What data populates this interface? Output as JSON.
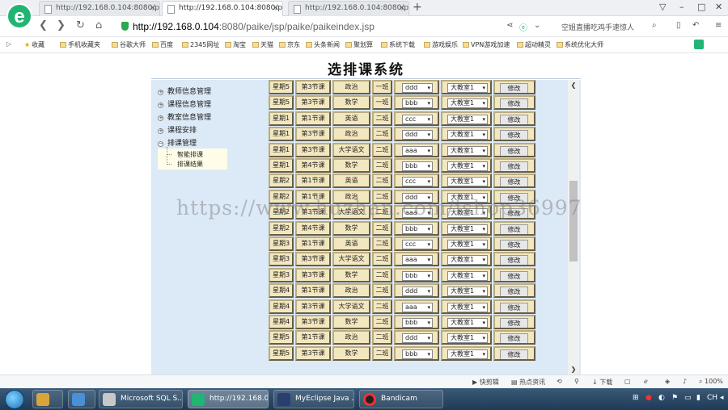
{
  "browser": {
    "logo_letter": "e",
    "tabs": [
      {
        "title": "http://192.168.0.104:8080/pai",
        "active": false
      },
      {
        "title": "http://192.168.0.104:8080/paik",
        "active": true
      },
      {
        "title": "http://192.168.0.104:8080/pai",
        "active": false
      }
    ],
    "new_tab_icon": "+",
    "window_controls": [
      "▽",
      "–",
      "□",
      "✕"
    ],
    "url_host": "http://192.168.0.104",
    "url_rest": ":8080/paike/jsp/paike/paikeindex.jsp",
    "address_hint": "空姐直播吃鸡手速惊人",
    "bookmarks": [
      "收藏",
      "手机收藏夹",
      "谷歌大师",
      "百度",
      "2345网址",
      "淘宝",
      "天猫",
      "京东",
      "头条新闻",
      "聚划算",
      "系统下载",
      "游戏娱乐",
      "VPN游戏加速",
      "超动精灵",
      "系统优化大师"
    ]
  },
  "app": {
    "title": "选排课系统",
    "sidebar": {
      "items": [
        {
          "label": "教师信息管理",
          "expanded": false
        },
        {
          "label": "课程信息管理",
          "expanded": false
        },
        {
          "label": "教室信息管理",
          "expanded": false
        },
        {
          "label": "课程安排",
          "expanded": false
        },
        {
          "label": "排课管理",
          "expanded": true
        }
      ],
      "sub_items": [
        "智能排课",
        "排课结果"
      ]
    },
    "action_label": "修改",
    "rows": [
      {
        "day": "星期5",
        "period": "第3节课",
        "course": "政治",
        "class": "一班",
        "teacher": "ddd",
        "room": "大教室1"
      },
      {
        "day": "星期5",
        "period": "第3节课",
        "course": "数学",
        "class": "一班",
        "teacher": "bbb",
        "room": "大教室1"
      },
      {
        "day": "星期1",
        "period": "第1节课",
        "course": "英语",
        "class": "二班",
        "teacher": "ccc",
        "room": "大教室1"
      },
      {
        "day": "星期1",
        "period": "第3节课",
        "course": "政治",
        "class": "二班",
        "teacher": "ddd",
        "room": "大教室1"
      },
      {
        "day": "星期1",
        "period": "第3节课",
        "course": "大学语文",
        "class": "二班",
        "teacher": "aaa",
        "room": "大教室1"
      },
      {
        "day": "星期1",
        "period": "第4节课",
        "course": "数学",
        "class": "二班",
        "teacher": "bbb",
        "room": "大教室1"
      },
      {
        "day": "星期2",
        "period": "第1节课",
        "course": "英语",
        "class": "二班",
        "teacher": "ccc",
        "room": "大教室1"
      },
      {
        "day": "星期2",
        "period": "第1节课",
        "course": "政治",
        "class": "二班",
        "teacher": "ddd",
        "room": "大教室1"
      },
      {
        "day": "星期2",
        "period": "第3节课",
        "course": "大学语文",
        "class": "二班",
        "teacher": "aaa",
        "room": "大教室1"
      },
      {
        "day": "星期2",
        "period": "第4节课",
        "course": "数学",
        "class": "二班",
        "teacher": "bbb",
        "room": "大教室1"
      },
      {
        "day": "星期3",
        "period": "第1节课",
        "course": "英语",
        "class": "二班",
        "teacher": "ccc",
        "room": "大教室1"
      },
      {
        "day": "星期3",
        "period": "第3节课",
        "course": "大学语文",
        "class": "二班",
        "teacher": "aaa",
        "room": "大教室1"
      },
      {
        "day": "星期3",
        "period": "第3节课",
        "course": "数学",
        "class": "二班",
        "teacher": "bbb",
        "room": "大教室1"
      },
      {
        "day": "星期4",
        "period": "第1节课",
        "course": "政治",
        "class": "二班",
        "teacher": "ddd",
        "room": "大教室1"
      },
      {
        "day": "星期4",
        "period": "第3节课",
        "course": "大学语文",
        "class": "二班",
        "teacher": "aaa",
        "room": "大教室1"
      },
      {
        "day": "星期4",
        "period": "第3节课",
        "course": "数学",
        "class": "二班",
        "teacher": "bbb",
        "room": "大教室1"
      },
      {
        "day": "星期5",
        "period": "第1节课",
        "course": "政治",
        "class": "二班",
        "teacher": "ddd",
        "room": "大教室1"
      },
      {
        "day": "星期5",
        "period": "第3节课",
        "course": "数学",
        "class": "二班",
        "teacher": "bbb",
        "room": "大教室1"
      }
    ]
  },
  "watermark": "https://www.huzhan.com/ishop36997",
  "status_bar": {
    "left": [
      "快剪辑",
      "热点资讯"
    ],
    "download": "下载",
    "zoom": "100%"
  },
  "taskbar": {
    "items": [
      {
        "label": "",
        "active": false
      },
      {
        "label": "",
        "active": false
      },
      {
        "label": "Microsoft SQL S...",
        "active": false
      },
      {
        "label": "http://192.168.0...",
        "active": true
      },
      {
        "label": "MyEclipse Java ...",
        "active": false
      },
      {
        "label": "Bandicam",
        "active": false
      }
    ],
    "tray_lang": "CH"
  },
  "colors": {
    "app_bg": "#dce9f7",
    "cell_bg": "#f3e7bf",
    "brand_green": "#21b573"
  }
}
